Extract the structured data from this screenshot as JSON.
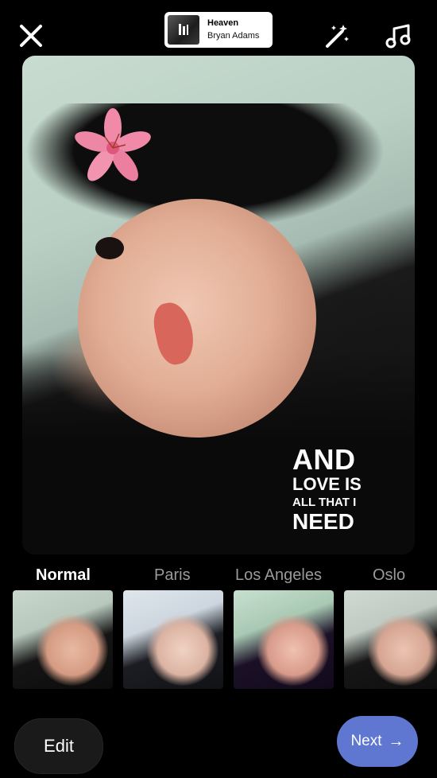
{
  "topbar": {
    "close_icon": "close-icon",
    "music": {
      "title": "Heaven",
      "artist": "Bryan Adams",
      "art_icon": "album-art-icon"
    },
    "effects_icon": "magic-wand-icon",
    "music_icon": "music-note-icon"
  },
  "photo": {
    "caption_lines": [
      "AND",
      "LOVE IS",
      "ALL THAT I",
      "NEED"
    ],
    "sticker": "pink-lily-flower-sticker"
  },
  "filters": {
    "labels": [
      "Normal",
      "Paris",
      "Los Angeles",
      "Oslo"
    ],
    "selected": "Normal"
  },
  "bottom": {
    "edit_label": "Edit",
    "next_label": "Next",
    "next_icon": "arrow-right-icon"
  },
  "colors": {
    "background": "#000000",
    "next_button": "#5f77d0",
    "edit_button": "#1a1a1a",
    "active_filter_text": "#ffffff",
    "inactive_filter_text": "#9a9a9a"
  }
}
